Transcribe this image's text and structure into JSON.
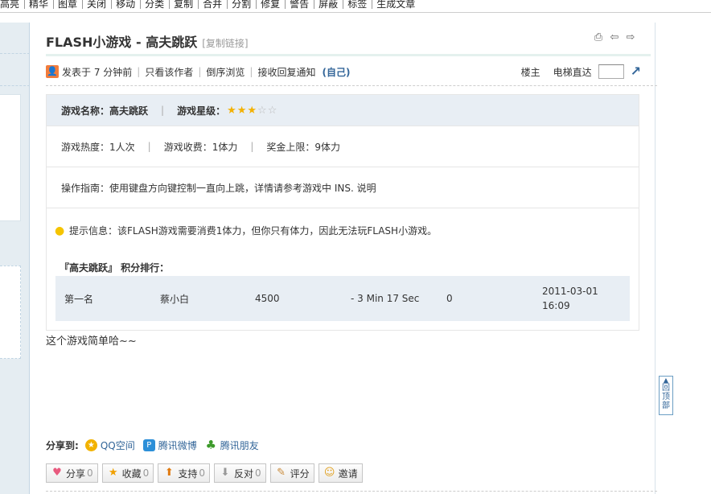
{
  "toolbar": {
    "items": [
      "高亮",
      "精华",
      "图章",
      "关闭",
      "移动",
      "分类",
      "复制",
      "合并",
      "分割",
      "修复",
      "警告",
      "屏蔽",
      "标签",
      "生成文章"
    ]
  },
  "thread": {
    "title": "FLASH小游戏 - 高夫跳跃",
    "copy_link": "[复制链接]",
    "icons": [
      "print-icon",
      "prev-thread-icon",
      "next-thread-icon"
    ]
  },
  "post_info": {
    "avatar_icon": "user-icon",
    "posted": "发表于 7 分钟前",
    "author_only": "只看该作者",
    "reverse_view": "倒序浏览",
    "reply_notify": "接收回复通知",
    "self": "(自己)",
    "floor": "楼主",
    "elevator": "电梯直达",
    "floor_input_value": ""
  },
  "game": {
    "name": "游戏名称：高夫跳跃",
    "rating_label": "游戏星级：",
    "rating": 3,
    "rating_max": 5,
    "heat": "游戏热度：1人次",
    "cost": "游戏收费：1体力",
    "reward_limit": "奖金上限：9体力",
    "guide": "操作指南：使用键盘方向键控制一直向上跳，详情请参考游戏中 INS. 说明",
    "tip": "提示信息：该FLASH游戏需要消费1体力，但你只有体力，因此无法玩FLASH小游戏。",
    "rank_title": "『高夫跳跃』 积分排行：",
    "rank": {
      "place": "第一名",
      "user": "蔡小白",
      "score": "4500",
      "time": "- 3 Min 17 Sec",
      "bonus": "0",
      "date": "2011-03-01",
      "clock": "16:09"
    }
  },
  "post_body": "这个游戏简单哈~~",
  "share": {
    "label": "分享到:",
    "items": [
      "QQ空间",
      "腾讯微博",
      "腾讯朋友"
    ]
  },
  "actions": [
    {
      "label": "分享",
      "count": "0",
      "icon": "heart-icon"
    },
    {
      "label": "收藏",
      "count": "0",
      "icon": "star-icon"
    },
    {
      "label": "支持",
      "count": "0",
      "icon": "thumbs-up-icon"
    },
    {
      "label": "反对",
      "count": "0",
      "icon": "thumbs-down-icon"
    },
    {
      "label": "评分",
      "count": "",
      "icon": "rate-icon"
    },
    {
      "label": "邀请",
      "count": "",
      "icon": "invite-icon"
    }
  ],
  "back_to_top": "回顶部",
  "colors": {
    "header_bg": "#e8eef4",
    "link": "#336699",
    "sidebar_bg": "#e5edf2"
  }
}
